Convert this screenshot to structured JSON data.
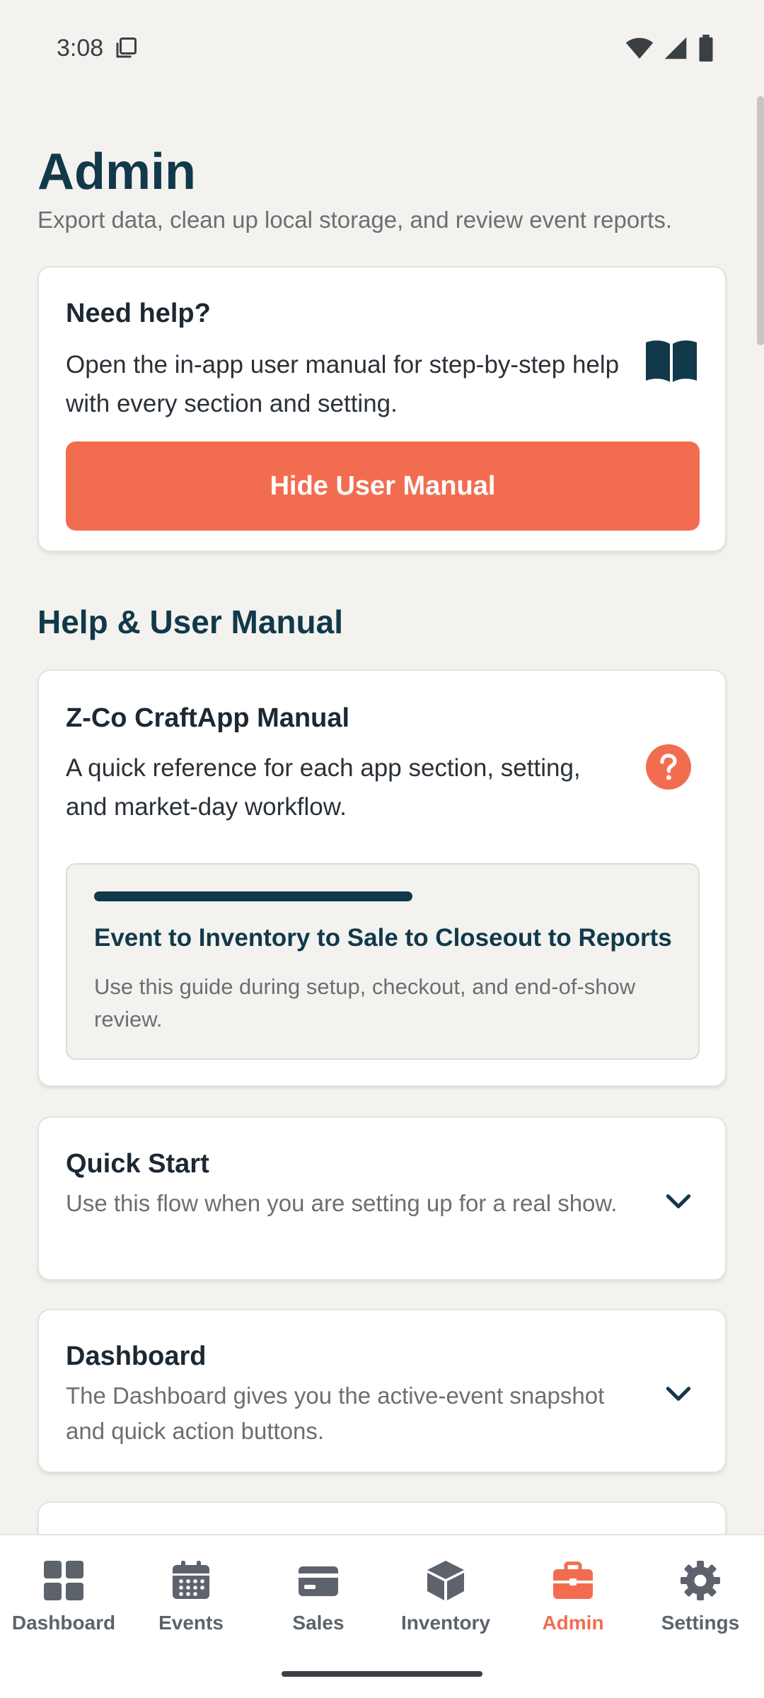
{
  "status_bar": {
    "time": "3:08"
  },
  "page": {
    "title": "Admin",
    "subtitle": "Export data, clean up local storage, and review event reports."
  },
  "help_card": {
    "title": "Need help?",
    "description": "Open the in-app user manual for step-by-step help with every section and setting.",
    "button_label": "Hide User Manual",
    "icon": "book-icon"
  },
  "manual_section": {
    "title": "Help & User Manual",
    "card": {
      "title": "Z-Co CraftApp Manual",
      "description": "A quick reference for each app section, setting, and market-day workflow.",
      "icon": "question-icon",
      "inner": {
        "title": "Event to Inventory to Sale to Closeout to Reports",
        "description": "Use this guide during setup, checkout, and end-of-show review."
      }
    },
    "accordions": [
      {
        "title": "Quick Start",
        "description": "Use this flow when you are setting up for a real show."
      },
      {
        "title": "Dashboard",
        "description": "The Dashboard gives you the active-event snapshot and quick action buttons."
      }
    ]
  },
  "bottom_nav": {
    "items": [
      {
        "label": "Dashboard",
        "icon": "dashboard-icon"
      },
      {
        "label": "Events",
        "icon": "calendar-icon"
      },
      {
        "label": "Sales",
        "icon": "card-icon"
      },
      {
        "label": "Inventory",
        "icon": "box-icon"
      },
      {
        "label": "Admin",
        "icon": "briefcase-icon",
        "active": true
      },
      {
        "label": "Settings",
        "icon": "gear-icon"
      }
    ]
  },
  "colors": {
    "accent": "#f26d50",
    "heading": "#11394a",
    "background": "#f3f2ef",
    "nav_inactive": "#5c636b"
  }
}
